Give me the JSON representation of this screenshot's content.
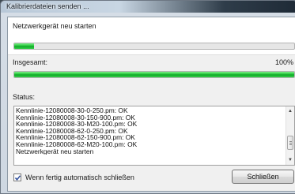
{
  "window": {
    "title": "Kalibrierdateien senden ..."
  },
  "step": {
    "label": "Netzwerkgerät neu starten",
    "progress_fraction": 0.07
  },
  "overall": {
    "label": "Insgesamt:",
    "percent_text": "100%",
    "progress_fraction": 1.0
  },
  "status": {
    "label": "Status:",
    "lines": [
      "Kennlinie-12080008-30-0-250.pm: OK",
      "Kennlinie-12080008-30-150-900.pm: OK",
      "Kennlinie-12080008-30-M20-100.pm: OK",
      "Kennlinie-12080008-62-0-250.pm: OK",
      "Kennlinie-12080008-62-150-900.pm: OK",
      "Kennlinie-12080008-62-M20-100.pm: OK",
      "Netzwerkgerät neu starten"
    ]
  },
  "options": {
    "auto_close_label": "Wenn fertig automatisch schließen",
    "auto_close_checked": true
  },
  "buttons": {
    "close_label": "Schließen"
  },
  "colors": {
    "progress_green": "#0ea826",
    "titlebar_dark": "#1e2a36"
  }
}
